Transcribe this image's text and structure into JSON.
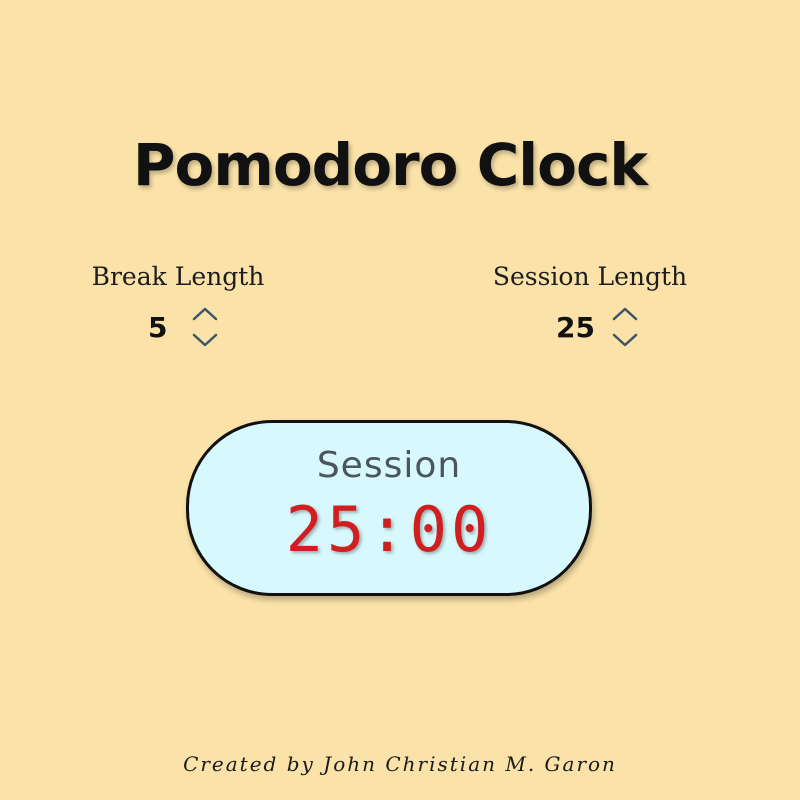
{
  "app": {
    "title": "Pomodoro Clock"
  },
  "break": {
    "label": "Break Length",
    "value": "5",
    "increment_icon": "chevron-up-icon",
    "decrement_icon": "chevron-down-icon"
  },
  "session": {
    "label": "Session Length",
    "value": "25",
    "increment_icon": "chevron-up-icon",
    "decrement_icon": "chevron-down-icon"
  },
  "timer": {
    "label": "Session",
    "time": "25:00"
  },
  "footer": {
    "credit": "Created by John Christian M. Garon"
  },
  "colors": {
    "background": "#fae2a8",
    "timer_background": "#d7f9fd",
    "timer_digits": "#d11f1f",
    "arrow": "#3d5566"
  }
}
